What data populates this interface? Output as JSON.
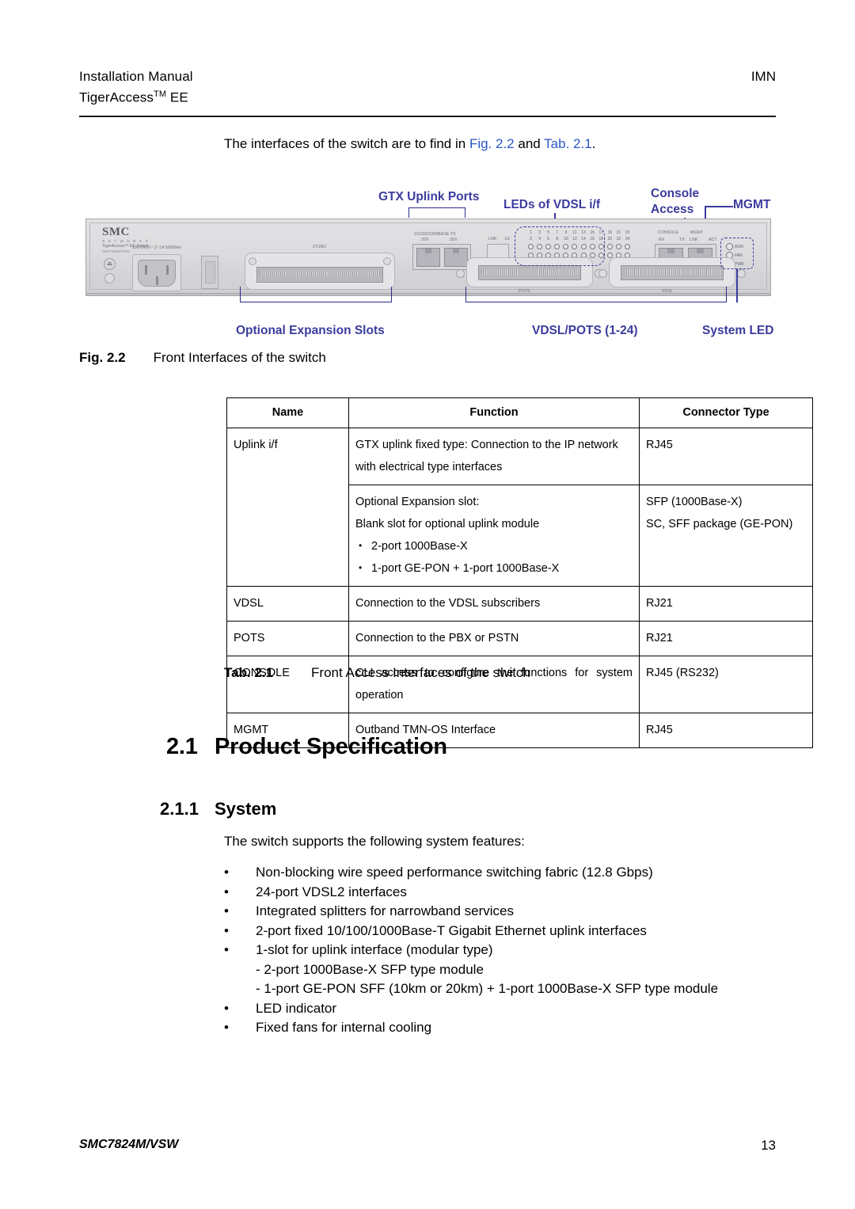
{
  "header": {
    "left_line1": "Installation Manual",
    "left_line2_pre": "TigerAccess",
    "left_line2_tm": "TM",
    "left_line2_post": " EE",
    "right": "IMN"
  },
  "intro": {
    "part1": "The interfaces of the switch are to find in ",
    "link1": "Fig. 2.2",
    "part2": " and ",
    "link2": "Tab. 2.1",
    "part3": ".",
    "link_color": "#2a56c6"
  },
  "figure": {
    "label_color": "#3b3b9e",
    "labels": {
      "gtx_uplink_ports": "GTX Uplink Ports",
      "leds_of_vdsl": "LEDs of VDSL i/f",
      "console_access_l1": "Console",
      "console_access_l2": "Access",
      "mgmt": "MGMT",
      "optional_expansion_slots": "Optional Expansion Slots",
      "vdsl_pots": "VDSL/POTS (1-24)",
      "system_led": "System LED"
    },
    "device": {
      "brand": "SMC",
      "brand_sub": "N E T W O R K S",
      "model_line": "TigerAccess™ EE Switch",
      "model_code": "SMC7824M/VSW",
      "power_rating": "100-240V~  2~1A  50/60Hz",
      "expansion_slot_label": "27/28X",
      "uplink_label": "10/100/1000BASE-TX",
      "uplink_port_a": "25X",
      "uplink_port_b": "26X",
      "sfp_label_lnk": "LNK",
      "sfp_label_1g": "1G",
      "pots_label": "POTS",
      "vdsl_label": "VDSL",
      "console_label": "CONSOLE",
      "console_rx": "RX",
      "console_tx": "TX",
      "mgmt_label": "MGMT",
      "mgmt_lnk": "LNK",
      "mgmt_act": "ACT",
      "led_numbers_top": [
        "1",
        "3",
        "5",
        "7",
        "9",
        "11",
        "13",
        "15",
        "17",
        "19",
        "21",
        "23"
      ],
      "led_numbers_bottom": [
        "2",
        "4",
        "6",
        "8",
        "10",
        "12",
        "14",
        "16",
        "18",
        "20",
        "22",
        "24"
      ],
      "system_leds": [
        "RUN",
        "FAN",
        "PWR"
      ]
    }
  },
  "figure_caption": {
    "label": "Fig. 2.2",
    "text": "Front Interfaces of the switch"
  },
  "table": {
    "headers": [
      "Name",
      "Function",
      "Connector Type"
    ],
    "rows": [
      {
        "name": "Uplink i/f",
        "name_rowspan": 2,
        "function_lines": [
          "GTX uplink fixed type: Connection to the IP network",
          "with electrical type interfaces"
        ],
        "function_bullets": [],
        "connector_lines": [
          "RJ45"
        ]
      },
      {
        "name": "",
        "function_lines": [
          "Optional Expansion slot:",
          "Blank slot for optional uplink module"
        ],
        "function_bullets": [
          "2-port 1000Base-X",
          "1-port GE-PON + 1-port 1000Base-X"
        ],
        "connector_lines": [
          "SFP (1000Base-X)",
          "SC, SFF package (GE-PON)"
        ]
      },
      {
        "name": "VDSL",
        "function_lines": [
          "Connection to the VDSL subscribers"
        ],
        "function_bullets": [],
        "connector_lines": [
          "RJ21"
        ]
      },
      {
        "name": "POTS",
        "function_lines": [
          "Connection to the PBX or PSTN"
        ],
        "function_bullets": [],
        "connector_lines": [
          "RJ21"
        ]
      },
      {
        "name": "CONSOLE",
        "function_lines": [
          "CLI access to configure the functions for system",
          "operation"
        ],
        "function_bullets": [],
        "connector_lines": [
          "RJ45 (RS232)"
        ]
      },
      {
        "name": "MGMT",
        "function_lines": [
          "Outband TMN-OS Interface"
        ],
        "function_bullets": [],
        "connector_lines": [
          "RJ45"
        ]
      }
    ]
  },
  "table_caption": {
    "label": "Tab. 2.1",
    "text": "Front Access Interfaces of the switch"
  },
  "section": {
    "h1_num": "2.1",
    "h1_title": "Product Specification",
    "h2_num": "2.1.1",
    "h2_title": "System",
    "intro_line": "The switch supports the following system features:",
    "features": [
      {
        "bullet": "•",
        "text": "Non-blocking wire speed performance switching fabric (12.8 Gbps)",
        "subs": []
      },
      {
        "bullet": "•",
        "text": "24-port VDSL2 interfaces",
        "subs": []
      },
      {
        "bullet": "•",
        "text": "Integrated splitters for narrowband services",
        "subs": []
      },
      {
        "bullet": "•",
        "text": "2-port fixed 10/100/1000Base-T Gigabit Ethernet uplink interfaces",
        "subs": []
      },
      {
        "bullet": "•",
        "text": "1-slot for uplink interface (modular type)",
        "subs": [
          "- 2-port 1000Base-X SFP type module",
          "- 1-port GE-PON SFF (10km or 20km) + 1-port 1000Base-X SFP type module"
        ]
      },
      {
        "bullet": "•",
        "text": "LED indicator",
        "subs": []
      },
      {
        "bullet": "•",
        "text": "Fixed fans for internal cooling",
        "subs": []
      }
    ]
  },
  "footer": {
    "left": "SMC7824M/VSW",
    "page": "13"
  }
}
